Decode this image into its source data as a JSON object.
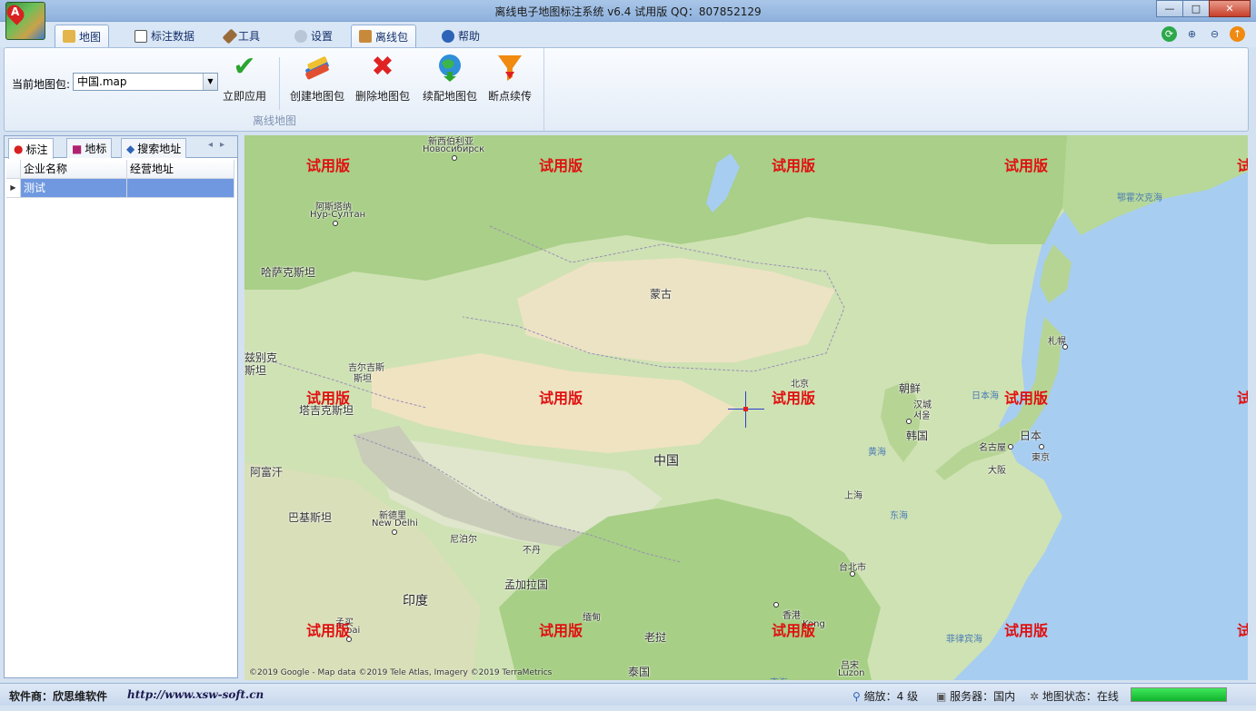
{
  "window": {
    "title": "离线电子地图标注系统 v6.4 试用版 QQ：807852129",
    "app_icon_letter": "A",
    "controls": {
      "minimize": "—",
      "maximize": "□",
      "close": "✕"
    }
  },
  "tabs": [
    {
      "label": "地图",
      "icon": "map-icon",
      "active": true
    },
    {
      "label": "标注数据",
      "icon": "table-icon",
      "active": false
    },
    {
      "label": "工具",
      "icon": "tools-icon",
      "active": false
    },
    {
      "label": "设置",
      "icon": "settings-icon",
      "active": false
    },
    {
      "label": "离线包",
      "icon": "package-icon",
      "active": false
    },
    {
      "label": "帮助",
      "icon": "help-icon",
      "active": false
    }
  ],
  "ribbon": {
    "current_map_label": "当前地图包:",
    "current_map_value": "中国.map",
    "apply_label": "立即应用",
    "create_label": "创建地图包",
    "delete_label": "删除地图包",
    "resume_label": "续配地图包",
    "breakpoint_label": "断点续传",
    "group_label": "离线地图"
  },
  "left_panel": {
    "tabs": [
      "标注",
      "地标",
      "搜索地址"
    ],
    "columns": [
      "企业名称",
      "经营地址"
    ],
    "rows": [
      {
        "name": "测试",
        "address": ""
      }
    ]
  },
  "map": {
    "watermark": "试用版",
    "copyright": "©2019 Google - Map data ©2019 Tele Atlas, Imagery ©2019 TerraMetrics",
    "labels": {
      "novosibirsk_cn": "新西伯利亚",
      "novosibirsk_ru": "Новосибирск",
      "astana_cn": "阿斯塔纳",
      "astana_ru": "Нур-Султан",
      "okhotsk": "鄂霍次克海",
      "kazakhstan": "哈萨克斯坦",
      "mongolia": "蒙古",
      "uzbekistan_1": "兹别克",
      "uzbekistan_2": "斯坦",
      "kyrgyzstan_1": "吉尔吉斯",
      "kyrgyzstan_2": "斯坦",
      "tajikistan": "塔吉克斯坦",
      "sapporo": "札幌",
      "beijing": "北京",
      "korea_north": "朝鲜",
      "seoul_1": "汉城",
      "seoul_2": "서울",
      "korea_south": "韩国",
      "sea_of_japan": "日本海",
      "japan": "日本",
      "nagoya": "名古屋",
      "osaka": "大阪",
      "tokyo": "東京",
      "yellow_sea": "黄海",
      "afghanistan": "阿富汗",
      "china": "中国",
      "shanghai": "上海",
      "east_sea": "东海",
      "pakistan": "巴基斯坦",
      "delhi_cn": "新德里",
      "delhi_en": "New Delhi",
      "nepal": "尼泊尔",
      "bhutan": "不丹",
      "taipei": "台北市",
      "bangladesh": "孟加拉国",
      "india": "印度",
      "myanmar": "缅甸",
      "hongkong_cn": "香港",
      "hongkong_en": "Kong",
      "philippine_sea": "菲律宾海",
      "mumbai_cn": "孟买",
      "mumbai_en": "bai",
      "laos": "老挝",
      "luzon_cn": "吕宋",
      "luzon_en": "Luzon",
      "thailand": "泰国",
      "south_sea": "南海"
    }
  },
  "status": {
    "vendor": "软件商：欣思维软件",
    "url": "http://www.xsw-soft.cn",
    "zoom": "缩放：4 级",
    "server": "服务器：国内",
    "map_state": "地图状态：在线",
    "progress": 1.0
  },
  "colors": {
    "watermark": "#e01010",
    "crosshair": "#2e3fd0",
    "selected_row": "#6f98e0",
    "progress_fill": "#11b32c"
  }
}
